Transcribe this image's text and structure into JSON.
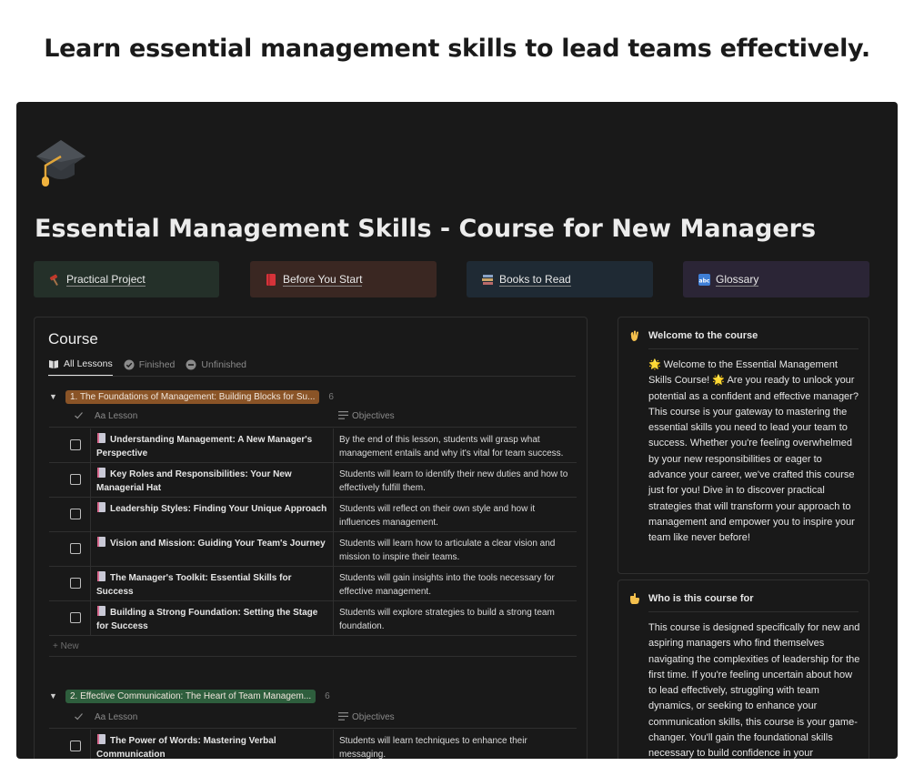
{
  "headline": "Learn essential management skills to lead teams effectively.",
  "page": {
    "icon": "graduation-cap-icon",
    "title": "Essential Management Skills - Course for New Managers"
  },
  "quick_links": [
    {
      "label": "Practical Project",
      "icon": "hammer-icon",
      "bg": "#243029"
    },
    {
      "label": "Before You Start",
      "icon": "book-red-icon",
      "bg": "#3a2722"
    },
    {
      "label": "Books to Read",
      "icon": "books-icon",
      "bg": "#1f2a34"
    },
    {
      "label": "Glossary",
      "icon": "abc-icon",
      "bg": "#2b2536"
    }
  ],
  "course": {
    "title": "Course",
    "views": [
      {
        "label": "All Lessons",
        "icon": "open-book-icon",
        "active": true
      },
      {
        "label": "Finished",
        "icon": "check-circle-icon",
        "active": false
      },
      {
        "label": "Unfinished",
        "icon": "minus-circle-icon",
        "active": false
      }
    ],
    "columns": {
      "lesson": "Aa Lesson",
      "objectives": "Objectives"
    },
    "new_label": "+ New",
    "groups": [
      {
        "label": "1. The Foundations of Management: Building Blocks for Su...",
        "count": "6",
        "color": "#8a5427",
        "rows": [
          {
            "lesson": "Understanding Management: A New Manager's Perspective",
            "objective": "By the end of this lesson, students will grasp what management entails and why it's vital for team success."
          },
          {
            "lesson": "Key Roles and Responsibilities: Your New Managerial Hat",
            "objective": "Students will learn to identify their new duties and how to effectively fulfill them."
          },
          {
            "lesson": "Leadership Styles: Finding Your Unique Approach",
            "objective": "Students will reflect on their own style and how it influences management."
          },
          {
            "lesson": "Vision and Mission: Guiding Your Team's Journey",
            "objective": "Students will learn how to articulate a clear vision and mission to inspire their teams."
          },
          {
            "lesson": "The Manager's Toolkit: Essential Skills for Success",
            "objective": "Students will gain insights into the tools necessary for effective management."
          },
          {
            "lesson": "Building a Strong Foundation: Setting the Stage for Success",
            "objective": "Students will explore strategies to build a strong team foundation."
          }
        ]
      },
      {
        "label": "2. Effective Communication: The Heart of Team Managem...",
        "count": "6",
        "color": "#2e5e3d",
        "rows": [
          {
            "lesson": "The Power of Words: Mastering Verbal Communication",
            "objective": "Students will learn techniques to enhance their messaging."
          }
        ]
      }
    ]
  },
  "side_cards": [
    {
      "title": "Welcome to the course",
      "icon": "waving-hand-icon",
      "body": "🌟 Welcome to the Essential Management Skills Course! 🌟  Are you ready to unlock your potential as a confident and effective manager? This course is your gateway to mastering the essential skills you need to lead your team to success. Whether you're feeling overwhelmed by your new responsibilities or eager to advance your career, we've crafted this course just for you! Dive in to discover practical strategies that will transform your approach to management and empower you to inspire your team like never before!"
    },
    {
      "title": "Who is this course for",
      "icon": "pointing-hand-icon",
      "body": "This course is designed specifically for new and aspiring managers who find themselves navigating the complexities of leadership for the first time. If you're feeling uncertain about how to lead effectively, struggling with team dynamics, or seeking to enhance your communication skills, this course is your game-changer. You'll gain the foundational skills necessary to build confidence in your"
    }
  ]
}
